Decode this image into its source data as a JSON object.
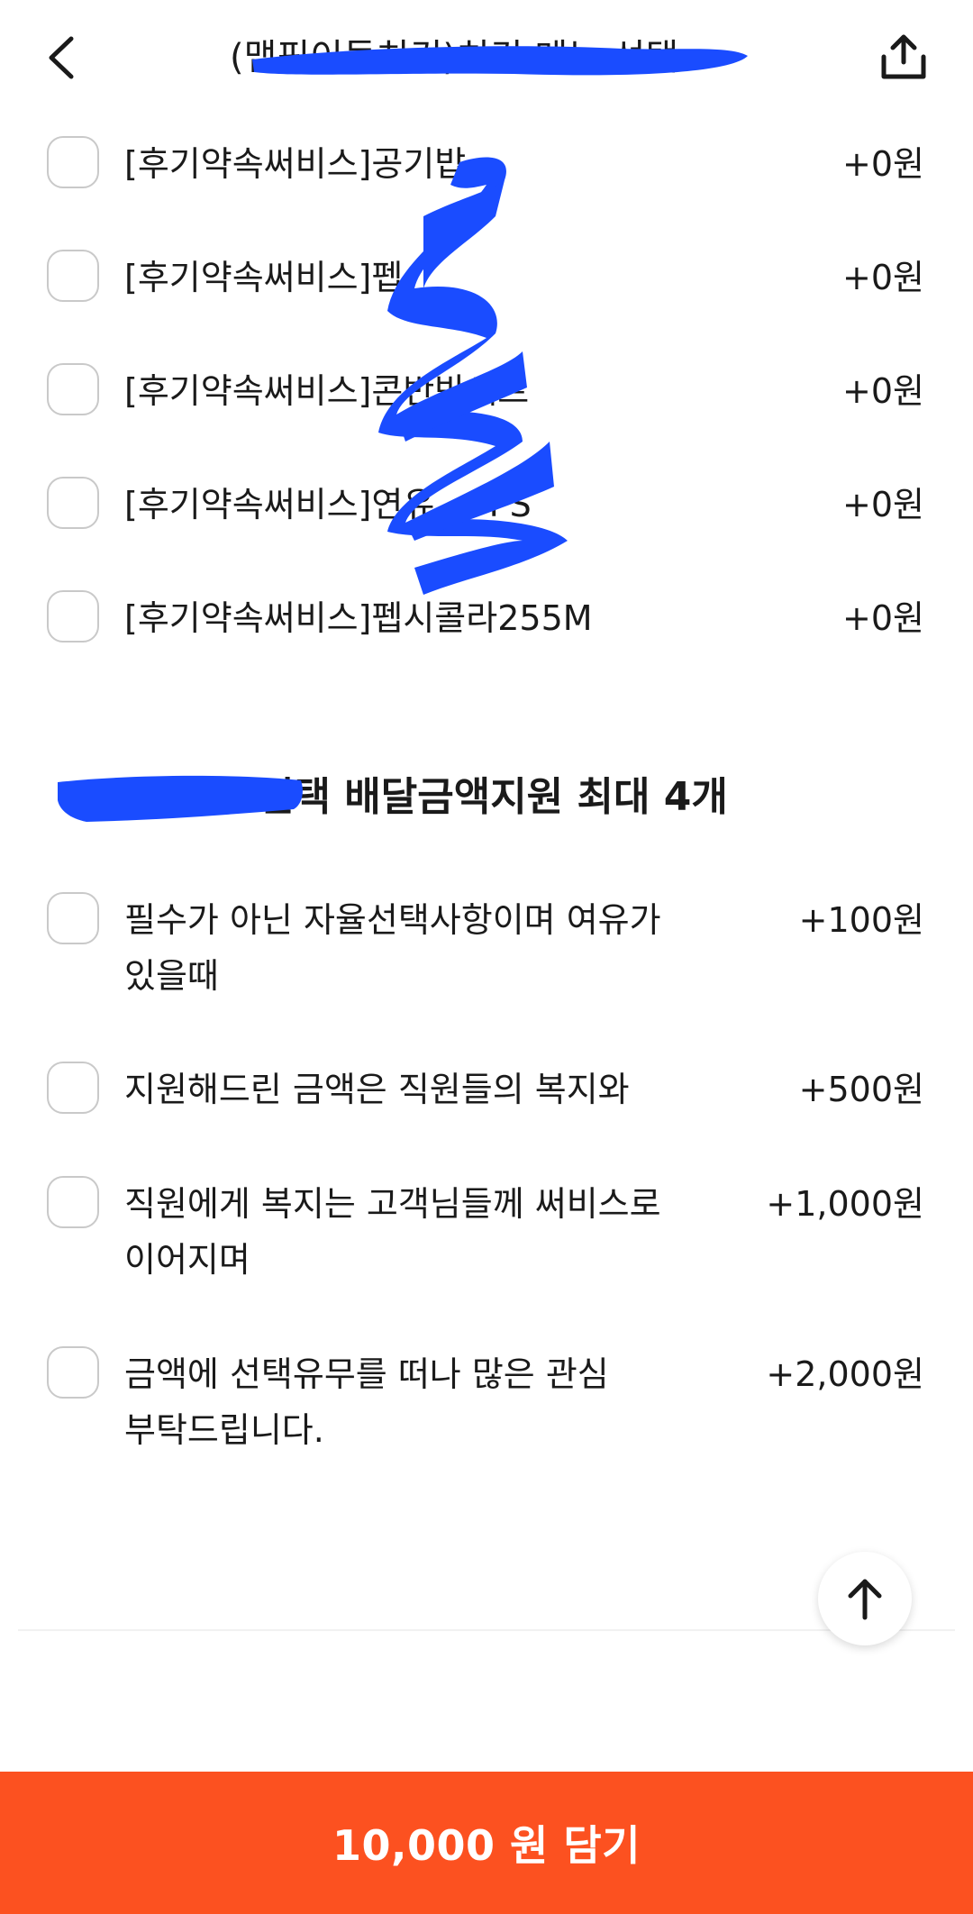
{
  "header": {
    "title": "(맵핑이들치킨)치킨 메뉴 선택"
  },
  "options_group_1": [
    {
      "label": "[후기약속써비스]공기밥",
      "price": "+0원"
    },
    {
      "label": "[후기약속써비스]펩",
      "price": "+0원"
    },
    {
      "label": "[후기약속써비스]콘반반세트",
      "price": "+0원"
    },
    {
      "label": "[후기약속써비스]연유 ... PS",
      "price": "+0원"
    },
    {
      "label": "[후기약속써비스]펩시콜라255M",
      "price": "+0원"
    }
  ],
  "section2": {
    "title": "선택 배달금액지원 최대 4개"
  },
  "options_group_2": [
    {
      "label": "필수가 아닌 자율선택사항이며 여유가 있을때",
      "price": "+100원"
    },
    {
      "label": "지원해드린 금액은 직원들의 복지와",
      "price": "+500원"
    },
    {
      "label": "직원에게 복지는 고객님들께 써비스로 이어지며",
      "price": "+1,000원"
    },
    {
      "label": "금액에 선택유무를 떠나 많은 관심 부탁드립니다.",
      "price": "+2,000원"
    }
  ],
  "cta": {
    "label": "10,000 원 담기"
  },
  "colors": {
    "accent": "#fc5120",
    "redaction": "#1a4cff",
    "checkbox_border": "#c9c9c9"
  },
  "icons": {
    "back": "chevron-left-icon",
    "share": "share-icon",
    "scroll_top": "arrow-up-icon"
  }
}
